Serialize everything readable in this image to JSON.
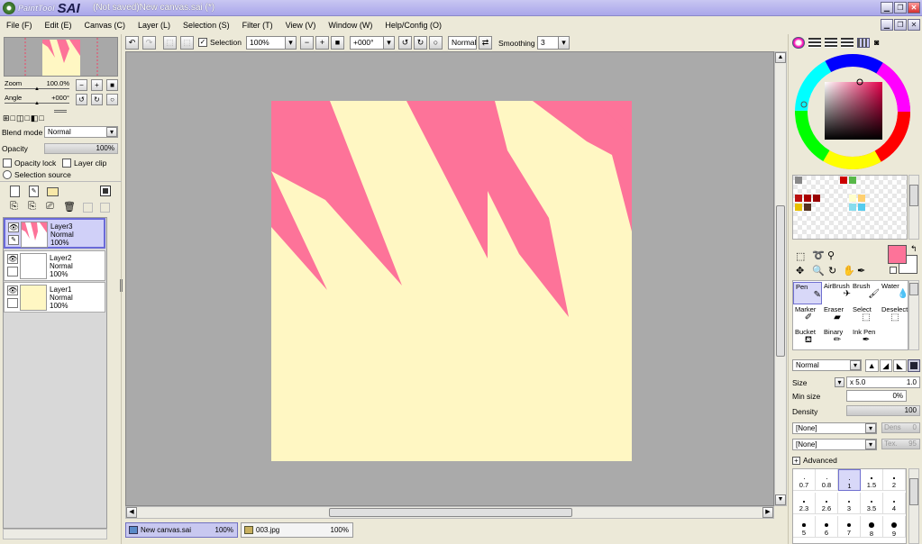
{
  "window": {
    "app_logo_small": "PaintTool",
    "app_logo_big": "SAI",
    "title": "(Not saved)New canvas.sai (*)"
  },
  "menu": [
    "File (F)",
    "Edit (E)",
    "Canvas (C)",
    "Layer (L)",
    "Selection (S)",
    "Filter (T)",
    "View (V)",
    "Window (W)",
    "Help/Config (O)"
  ],
  "navigator": {
    "zoom_label": "Zoom",
    "zoom_value": "100.0%",
    "angle_label": "Angle",
    "angle_value": "+000°"
  },
  "layer_panel": {
    "blend_label": "Blend mode",
    "blend_value": "Normal",
    "opacity_label": "Opacity",
    "opacity_value": "100%",
    "opacity_lock": "Opacity lock",
    "layer_clip": "Layer clip",
    "selection_source": "Selection source",
    "layers": [
      {
        "name": "Layer3",
        "mode": "Normal",
        "opacity": "100%",
        "selected": true
      },
      {
        "name": "Layer2",
        "mode": "Normal",
        "opacity": "100%",
        "selected": false
      },
      {
        "name": "Layer1",
        "mode": "Normal",
        "opacity": "100%",
        "selected": false
      }
    ]
  },
  "toolbar": {
    "selection_label": "Selection",
    "zoom": "100%",
    "angle": "+000°",
    "mode": "Normal",
    "smoothing_label": "Smoothing",
    "smoothing_value": "3"
  },
  "canvas": {
    "bg_color": "#fff7c3",
    "stroke_color": "#fd7399"
  },
  "tabs": [
    {
      "name": "New canvas.sai",
      "zoom": "100%",
      "active": true
    },
    {
      "name": "003.jpg",
      "zoom": "100%",
      "active": false
    }
  ],
  "tools": [
    {
      "label": "Pen",
      "icon": "pen-icon",
      "selected": true
    },
    {
      "label": "AirBrush",
      "icon": "airbrush-icon",
      "selected": false
    },
    {
      "label": "Brush",
      "icon": "brush-icon",
      "selected": false
    },
    {
      "label": "Water",
      "icon": "water-icon",
      "selected": false
    },
    {
      "label": "Marker",
      "icon": "marker-icon",
      "selected": false
    },
    {
      "label": "Eraser",
      "icon": "eraser-icon",
      "selected": false
    },
    {
      "label": "Select",
      "icon": "select-icon",
      "selected": false
    },
    {
      "label": "Deselect",
      "icon": "deselect-icon",
      "selected": false
    },
    {
      "label": "Bucket",
      "icon": "bucket-icon",
      "selected": false
    },
    {
      "label": "Binary",
      "icon": "binary-pen-icon",
      "selected": false
    },
    {
      "label": "Ink Pen",
      "icon": "ink-pen-icon",
      "selected": false
    }
  ],
  "brush": {
    "mode": "Normal",
    "size_label": "Size",
    "size_mult": "x 5.0",
    "size_value": "1.0",
    "min_size_label": "Min size",
    "min_size_value": "0%",
    "density_label": "Density",
    "density_value": "100",
    "texture1": "[None]",
    "texture1_field": "Dens",
    "texture1_value": "0",
    "texture2": "[None]",
    "texture2_field": "Tex.",
    "texture2_value": "95",
    "advanced_label": "Advanced",
    "sizes": [
      "0.7",
      "0.8",
      "1",
      "1.5",
      "2",
      "2.3",
      "2.6",
      "3",
      "3.5",
      "4",
      "5",
      "6",
      "7",
      "8",
      "9"
    ],
    "selected_size": "1"
  },
  "colors": {
    "primary": "#fd7399",
    "secondary": "#ffffff",
    "swatches": [
      "#888888",
      "#cc0000",
      "#58b848",
      "#bb1111",
      "#aa0000",
      "#990000",
      "#ffffcc",
      "#ffd070",
      "#e8c000",
      "#553322",
      "#88ddee",
      "#55ccee"
    ]
  }
}
